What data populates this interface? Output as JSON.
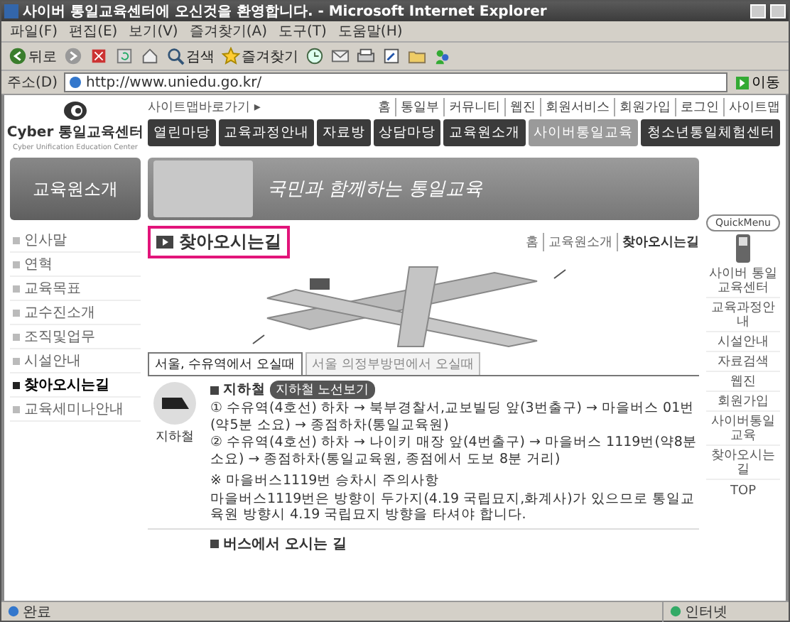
{
  "window": {
    "title": "사이버 통일교육센터에 오신것을 환영합니다. - Microsoft Internet Explorer"
  },
  "menu_bar": [
    "파일(F)",
    "편집(E)",
    "보기(V)",
    "즐겨찾기(A)",
    "도구(T)",
    "도움말(H)"
  ],
  "toolbar": [
    {
      "kind": "back",
      "label": "뒤로"
    },
    {
      "kind": "forward"
    },
    {
      "kind": "stop"
    },
    {
      "kind": "refresh"
    },
    {
      "kind": "home"
    },
    {
      "kind": "search",
      "label": "검색"
    },
    {
      "kind": "favorites",
      "label": "즐겨찾기"
    },
    {
      "kind": "history"
    },
    {
      "kind": "mail"
    },
    {
      "kind": "print"
    },
    {
      "kind": "edit"
    },
    {
      "kind": "folder"
    },
    {
      "kind": "messenger"
    }
  ],
  "address_bar": {
    "label": "주소(D)",
    "url": "http://www.uniedu.go.kr/",
    "go": "이동"
  },
  "site": {
    "logo": {
      "name": "Cyber 통일교육센터",
      "subtitle": "Cyber Unification Education Center"
    },
    "skip_link": "사이트맵바로가기 ▸",
    "top_links": [
      "홈",
      "통일부",
      "커뮤니티",
      "웹진",
      "회원서비스",
      "회원가입",
      "로그인",
      "사이트맵"
    ],
    "nav": [
      {
        "label": "열린마당",
        "kind": "main"
      },
      {
        "label": "교육과정안내",
        "kind": "main"
      },
      {
        "label": "자료방",
        "kind": "main"
      },
      {
        "label": "상담마당",
        "kind": "main"
      },
      {
        "label": "교육원소개",
        "kind": "main"
      },
      {
        "label": "사이버통일교육",
        "kind": "light"
      },
      {
        "label": "청소년통일체험센터",
        "kind": "main"
      }
    ],
    "sidebar": {
      "title": "교육원소개",
      "items": [
        {
          "label": "인사말",
          "selected": false
        },
        {
          "label": "연혁",
          "selected": false
        },
        {
          "label": "교육목표",
          "selected": false
        },
        {
          "label": "교수진소개",
          "selected": false
        },
        {
          "label": "조직및업무",
          "selected": false
        },
        {
          "label": "시설안내",
          "selected": false
        },
        {
          "label": "찾아오시는길",
          "selected": true
        },
        {
          "label": "교육세미나안내",
          "selected": false
        }
      ]
    },
    "banner": {
      "headline": "국민과 함께하는 통일교육"
    },
    "page_title": "찾아오시는길",
    "breadcrumb": [
      "홈",
      "교육원소개",
      "찾아오시는길"
    ],
    "tabs": [
      {
        "label": "서울, 수유역에서 오실때",
        "selected": true
      },
      {
        "label": "서울 의정부방면에서 오실때",
        "selected": false
      }
    ],
    "sections": [
      {
        "kind": "subway",
        "title": "지하철",
        "badge": "지하철 노선보기",
        "icon_caption": "지하철",
        "lines": [
          "① 수유역(4호선) 하차 → 북부경찰서,교보빌딩 앞(3번출구) → 마을버스 01번(약5분 소요) → 종점하차(통일교육원)",
          "② 수유역(4호선) 하차 → 나이키 매장 앞(4번출구) → 마을버스 1119번(약8분 소요) → 종점하차(통일교육원, 종점에서 도보 8분 거리)"
        ],
        "notes": [
          "※ 마을버스1119번 승차시 주의사항",
          "마을버스1119번은 방향이 두가지(4.19 국립묘지,화계사)가 있으므로 통일교육원 방향시 4.19 국립묘지 방향을 타셔야 합니다."
        ]
      },
      {
        "kind": "bus",
        "title": "버스에서 오시는 길"
      }
    ],
    "quick_menu": {
      "title": "QuickMenu",
      "items": [
        "사이버 통일교육센터",
        "교육과정안내",
        "시설안내",
        "자료검색",
        "웹진",
        "회원가입",
        "사이버통일교육",
        "찾아오시는길"
      ],
      "top": "TOP"
    }
  },
  "status_bar": {
    "text": "완료",
    "zone": "인터넷"
  }
}
